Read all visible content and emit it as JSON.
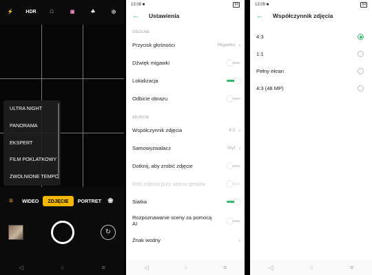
{
  "camera": {
    "top_icons": [
      "⚡",
      "HDR",
      "□",
      "▣",
      "☘",
      "◎"
    ],
    "mode_menu": [
      "ULTRA NIGHT",
      "PANORAMA",
      "EKSPERT",
      "FILM POKLATKOWY",
      "ZWOLNIONE TEMPO"
    ],
    "mode_bar": {
      "menu_icon": "≡",
      "video": "WIDEO",
      "photo": "ZDJĘCIE",
      "portrait": "PORTRET",
      "filter_icon": "❀"
    },
    "flip_icon": "↻",
    "nav": [
      "◁",
      "○",
      "≡"
    ]
  },
  "settings1": {
    "status_time": "13:08 ■",
    "battery": "84",
    "title": "Ustawienia",
    "back": "←",
    "section_general": "OGÓLNE",
    "rows_general": [
      {
        "label": "Przycisk głośności",
        "value": "Migawka",
        "chev": "›"
      },
      {
        "label": "Dźwięk migawki"
      },
      {
        "label": "Lokalizacja"
      },
      {
        "label": "Odbicie obrazu"
      }
    ],
    "section_photo": "ZDJĘCIE",
    "rows_photo": [
      {
        "label": "Współczynnik zdjęcia",
        "value": "4:3",
        "chev": "›"
      },
      {
        "label": "Samowyzwalacz",
        "value": "Wył",
        "chev": "›"
      },
      {
        "label": "Dotknij, aby zrobić zdjęcie"
      },
      {
        "label": "Rób zdjęcia przy użyciu gestów"
      },
      {
        "label": "Siatka"
      },
      {
        "label": "Rozpoznawanie sceny za pomocą AI"
      },
      {
        "label": "Znak wodny",
        "chev": "›"
      }
    ],
    "toggles": {
      "shutter_sound": false,
      "location": true,
      "mirror": false,
      "tap_to_shoot": false,
      "gestures": false,
      "grid": true,
      "ai_scene": false
    },
    "nav": [
      "◁",
      "○",
      "≡"
    ]
  },
  "settings2": {
    "status_time": "13:09 ■",
    "battery": "84",
    "title": "Współczynnik zdjęcia",
    "back": "←",
    "options": [
      {
        "label": "4:3",
        "selected": true
      },
      {
        "label": "1:1",
        "selected": false
      },
      {
        "label": "Pełny ekran",
        "selected": false
      },
      {
        "label": "4:3 (48 MP)",
        "selected": false
      }
    ],
    "nav": [
      "◁",
      "○",
      "≡"
    ]
  },
  "colors": {
    "accent": "#2fbd6b",
    "camera_yellow": "#f5b800"
  }
}
